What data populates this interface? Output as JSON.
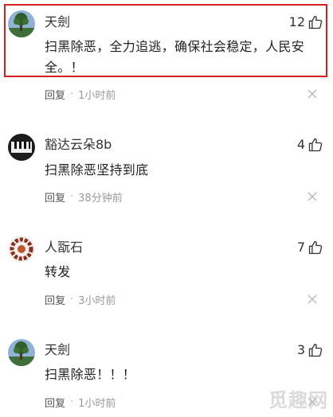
{
  "comments": [
    {
      "username": "天劍",
      "likes": "12",
      "content": "扫黑除恶，全力追逃，确保社会稳定，人民安全。！",
      "reply_label": "回复",
      "time": "1小时前",
      "highlighted": true
    },
    {
      "username": "豁达云朵8b",
      "likes": "4",
      "content": "扫黑除恶坚持到底",
      "reply_label": "回复",
      "time": "38分钟前",
      "highlighted": false
    },
    {
      "username": "人翫石",
      "likes": "7",
      "content": "转发",
      "reply_label": "回复",
      "time": "3小时前",
      "highlighted": false
    },
    {
      "username": "天劍",
      "likes": "3",
      "content": "扫黑除恶！！！",
      "reply_label": "回复",
      "time": "1小时前",
      "highlighted": false
    }
  ],
  "watermark": "觅趣网",
  "colors": {
    "highlight_border": "#d81e1e",
    "meta_text": "#888888"
  },
  "icons": {
    "like": "thumbs-up-icon",
    "close": "close-icon",
    "separator": "dot-separator"
  }
}
